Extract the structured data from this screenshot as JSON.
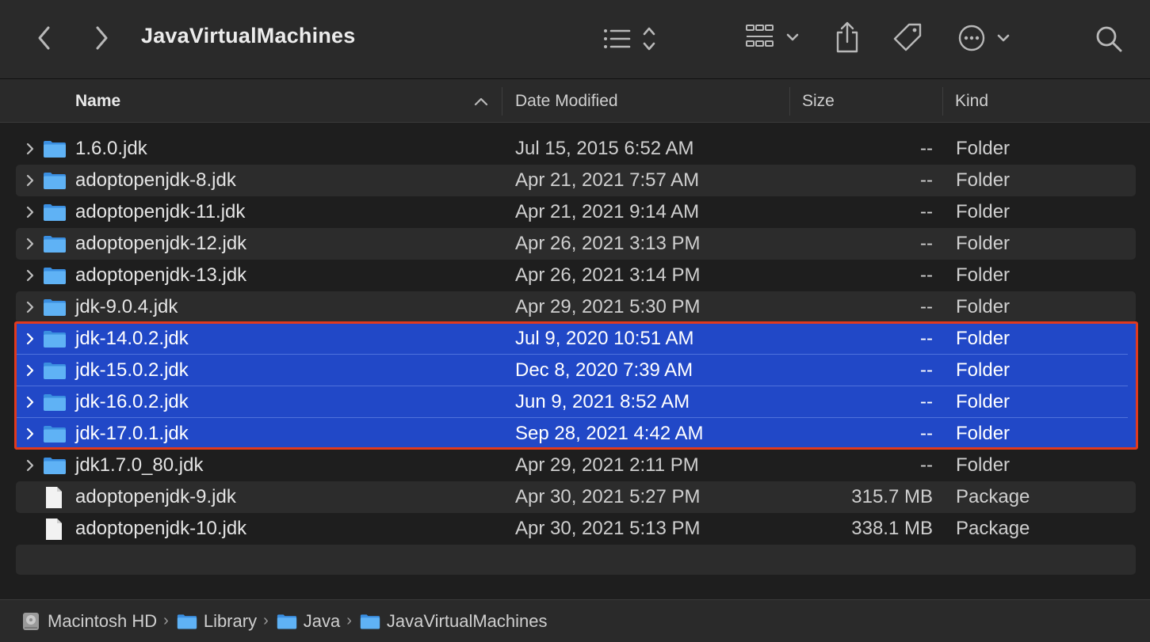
{
  "window": {
    "title": "JavaVirtualMachines"
  },
  "toolbar": {
    "back_icon": "chevron-left-icon",
    "forward_icon": "chevron-right-icon",
    "view_icon": "list-view-icon",
    "group_icon": "group-grid-icon",
    "share_icon": "share-icon",
    "tag_icon": "tag-icon",
    "more_icon": "ellipsis-circle-icon",
    "search_icon": "search-icon"
  },
  "columns": {
    "name": "Name",
    "date": "Date Modified",
    "size": "Size",
    "kind": "Kind",
    "sort": "ascending"
  },
  "rows": [
    {
      "name": "1.6.0.jdk",
      "date": "Jul 15, 2015 6:52 AM",
      "size": "--",
      "kind": "Folder",
      "type": "folder",
      "selected": false
    },
    {
      "name": "adoptopenjdk-8.jdk",
      "date": "Apr 21, 2021 7:57 AM",
      "size": "--",
      "kind": "Folder",
      "type": "folder",
      "selected": false
    },
    {
      "name": "adoptopenjdk-11.jdk",
      "date": "Apr 21, 2021 9:14 AM",
      "size": "--",
      "kind": "Folder",
      "type": "folder",
      "selected": false
    },
    {
      "name": "adoptopenjdk-12.jdk",
      "date": "Apr 26, 2021 3:13 PM",
      "size": "--",
      "kind": "Folder",
      "type": "folder",
      "selected": false
    },
    {
      "name": "adoptopenjdk-13.jdk",
      "date": "Apr 26, 2021 3:14 PM",
      "size": "--",
      "kind": "Folder",
      "type": "folder",
      "selected": false
    },
    {
      "name": "jdk-9.0.4.jdk",
      "date": "Apr 29, 2021 5:30 PM",
      "size": "--",
      "kind": "Folder",
      "type": "folder",
      "selected": false
    },
    {
      "name": "jdk-14.0.2.jdk",
      "date": "Jul 9, 2020 10:51 AM",
      "size": "--",
      "kind": "Folder",
      "type": "folder",
      "selected": true
    },
    {
      "name": "jdk-15.0.2.jdk",
      "date": "Dec 8, 2020 7:39 AM",
      "size": "--",
      "kind": "Folder",
      "type": "folder",
      "selected": true
    },
    {
      "name": "jdk-16.0.2.jdk",
      "date": "Jun 9, 2021 8:52 AM",
      "size": "--",
      "kind": "Folder",
      "type": "folder",
      "selected": true
    },
    {
      "name": "jdk-17.0.1.jdk",
      "date": "Sep 28, 2021 4:42 AM",
      "size": "--",
      "kind": "Folder",
      "type": "folder",
      "selected": true
    },
    {
      "name": "jdk1.7.0_80.jdk",
      "date": "Apr 29, 2021 2:11 PM",
      "size": "--",
      "kind": "Folder",
      "type": "folder",
      "selected": false
    },
    {
      "name": "adoptopenjdk-9.jdk",
      "date": "Apr 30, 2021 5:27 PM",
      "size": "315.7 MB",
      "kind": "Package",
      "type": "package",
      "selected": false
    },
    {
      "name": "adoptopenjdk-10.jdk",
      "date": "Apr 30, 2021 5:13 PM",
      "size": "338.1 MB",
      "kind": "Package",
      "type": "package",
      "selected": false
    }
  ],
  "pathbar": [
    {
      "label": "Macintosh HD",
      "icon": "hard-drive-icon"
    },
    {
      "label": "Library",
      "icon": "folder-icon"
    },
    {
      "label": "Java",
      "icon": "folder-icon"
    },
    {
      "label": "JavaVirtualMachines",
      "icon": "folder-icon"
    }
  ],
  "colors": {
    "selection": "#2148c7",
    "folder": "#4aa3ef",
    "annotation_border": "#e03a1e"
  }
}
